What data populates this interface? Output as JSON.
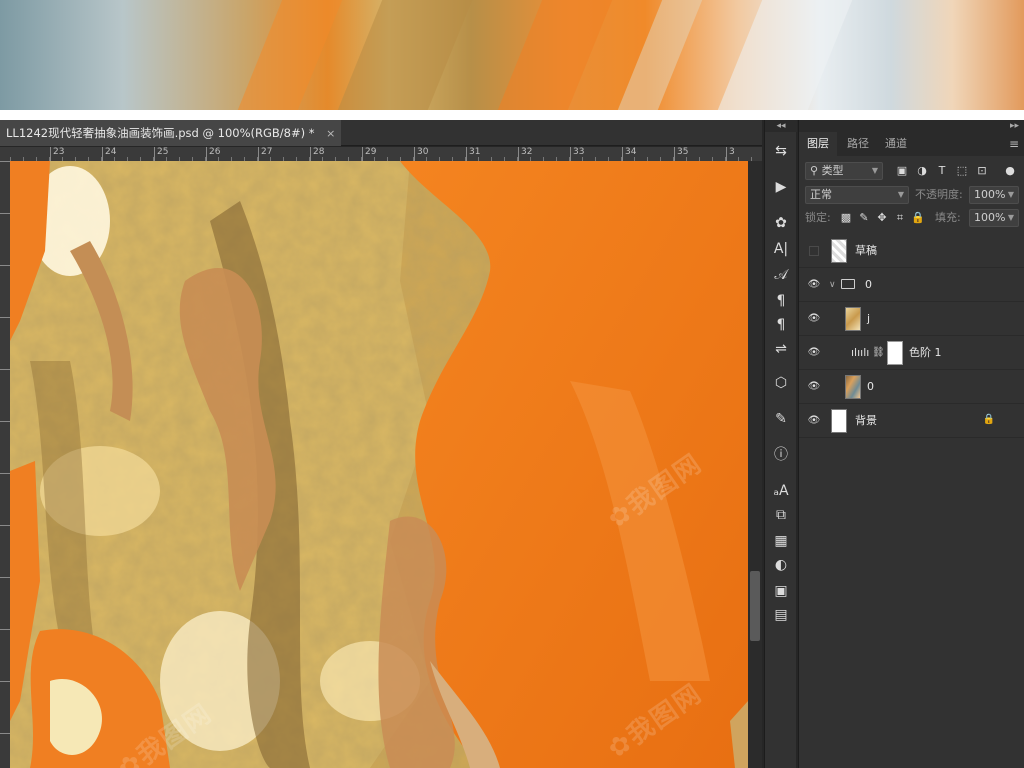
{
  "document": {
    "tab_title": "LL1242现代轻奢抽象油画装饰画.psd @ 100%(RGB/8#) *",
    "close_glyph": "×"
  },
  "ruler": {
    "top_labels": [
      "23",
      "24",
      "25",
      "26",
      "27",
      "28",
      "29",
      "30",
      "31",
      "32",
      "33",
      "34",
      "35",
      "3"
    ]
  },
  "colors": {
    "accent_orange": "#f07a1a",
    "gold": "#c9a14a",
    "panel_bg": "#323232",
    "app_bg": "#262626"
  },
  "tools": [
    {
      "name": "history-icon",
      "glyph": "⇆"
    },
    {
      "name": "play-icon",
      "glyph": "▶"
    },
    {
      "name": "palette-icon",
      "glyph": "✿"
    },
    {
      "name": "character-icon",
      "glyph": "A|"
    },
    {
      "name": "glyphs-icon",
      "glyph": "𝒜"
    },
    {
      "name": "paragraph-styles-icon",
      "glyph": "¶"
    },
    {
      "name": "paragraph-icon",
      "glyph": "¶"
    },
    {
      "name": "adjustments-icon",
      "glyph": "⇌"
    },
    {
      "name": "3d-icon",
      "glyph": "⬡"
    },
    {
      "name": "brush-settings-icon",
      "glyph": "✎"
    },
    {
      "name": "info-icon",
      "glyph": "ⓘ"
    },
    {
      "name": "character-styles-icon",
      "glyph": "ₐA"
    },
    {
      "name": "clone-source-icon",
      "glyph": "⧉"
    },
    {
      "name": "grid-icon",
      "glyph": "▦"
    },
    {
      "name": "adjustment-layer-icon",
      "glyph": "◐"
    },
    {
      "name": "properties-icon",
      "glyph": "▣"
    },
    {
      "name": "notes-icon",
      "glyph": "▤"
    }
  ],
  "panel": {
    "tabs": [
      "图层",
      "路径",
      "通道"
    ],
    "active_tab": "图层",
    "filter_kind": "类型",
    "blend_mode": "正常",
    "opacity_label": "不透明度:",
    "opacity_value": "100%",
    "lock_label": "锁定:",
    "fill_label": "填充:",
    "fill_value": "100%"
  },
  "layers": [
    {
      "name": "草稿",
      "visible": false,
      "type": "pixel"
    },
    {
      "name": "0",
      "visible": true,
      "type": "group"
    },
    {
      "name": "j",
      "visible": true,
      "type": "pixel"
    },
    {
      "name": "色阶 1",
      "visible": true,
      "type": "adjustment"
    },
    {
      "name": "0",
      "visible": true,
      "type": "pixel"
    },
    {
      "name": "背景",
      "visible": true,
      "type": "background",
      "locked": true
    }
  ]
}
